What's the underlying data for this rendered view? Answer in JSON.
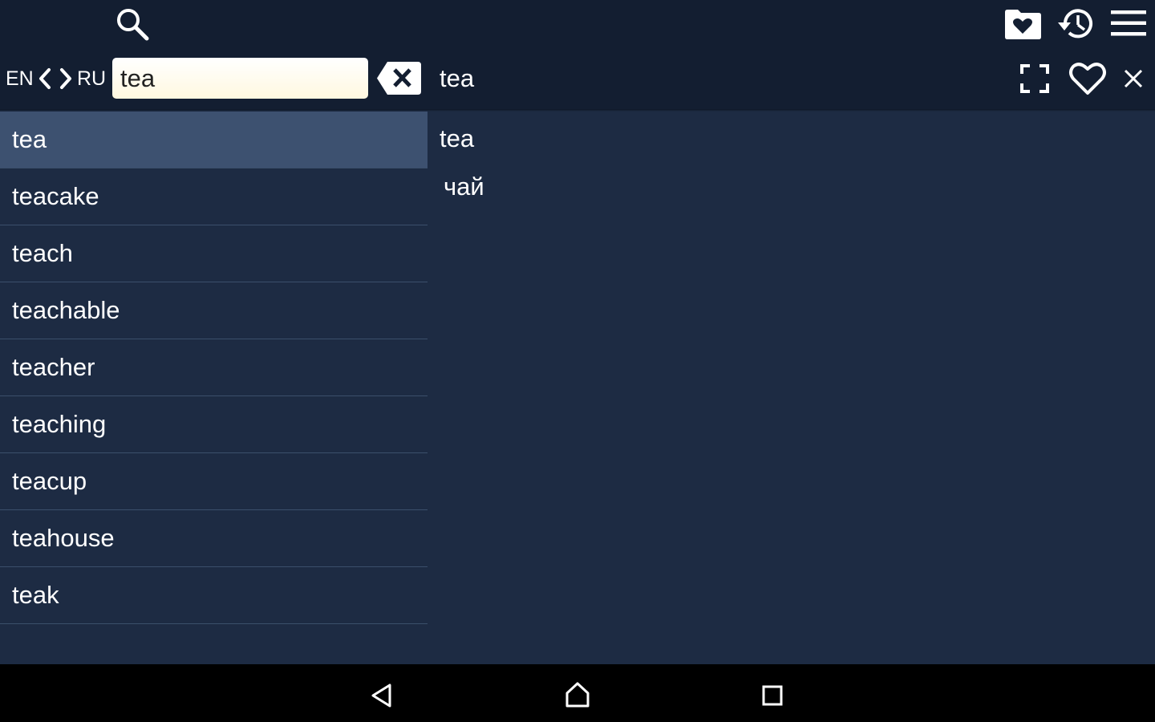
{
  "toolbar": {
    "search_icon": "search-icon",
    "favorites_folder_icon": "folder-heart-icon",
    "history_icon": "history-icon",
    "menu_icon": "menu-icon"
  },
  "search": {
    "source_lang": "EN",
    "target_lang": "RU",
    "query": "tea",
    "clear_icon": "backspace-clear-icon"
  },
  "header": {
    "word": "tea",
    "fullscreen_icon": "fullscreen-icon",
    "favorite_icon": "heart-outline-icon",
    "close_icon": "close-icon"
  },
  "word_list": {
    "selected_index": 0,
    "items": [
      {
        "label": "tea"
      },
      {
        "label": "teacake"
      },
      {
        "label": "teach"
      },
      {
        "label": "teachable"
      },
      {
        "label": "teacher"
      },
      {
        "label": "teaching"
      },
      {
        "label": "teacup"
      },
      {
        "label": "teahouse"
      },
      {
        "label": "teak"
      }
    ]
  },
  "entry": {
    "headword": "tea",
    "translation": "чай"
  },
  "navbar": {
    "back": "back-icon",
    "home": "home-icon",
    "recents": "recents-icon"
  },
  "colors": {
    "topbar": "#131e31",
    "content": "#1d2b43",
    "selected": "#3d5170",
    "divider": "#3b4f6b"
  }
}
